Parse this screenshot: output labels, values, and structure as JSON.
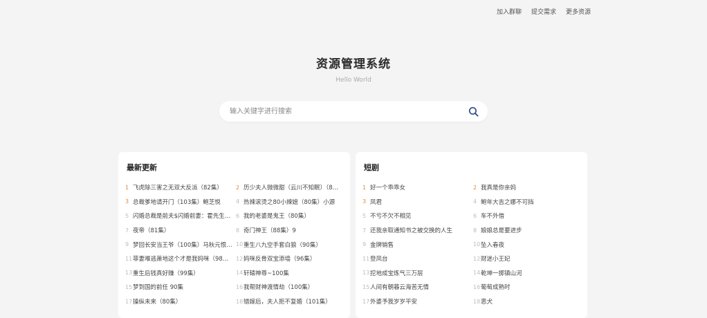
{
  "nav": [
    "加入群聊",
    "提交需求",
    "更多资源"
  ],
  "brand": {
    "title": "资源管理系统",
    "subtitle": "Hello World"
  },
  "search": {
    "placeholder": "输入关键字进行搜索",
    "value": ""
  },
  "colors": {
    "accent": "#e8842e",
    "rank_default": "#bbbbbb",
    "search_icon": "#2b4d8c"
  },
  "icons": {
    "search": "search-icon"
  },
  "sections": [
    {
      "title": "最新更新",
      "items": [
        "飞虎除三害之无双大反派（82集）",
        "历少夫人微微甜（云川不知眠）（8…",
        "总裁爹地请开门（103集）鲍芝悦",
        "热辣滚烫之80小辣媳（80集）小源",
        "闪婚总裁是前夫$闪婚前妻：霍先生…",
        "我的老婆是鬼王（80集）",
        "夜帝（81集）",
        "奇门神王（88集）9",
        "梦回长安当王爷（100集）马秋元恨…",
        "重生八九空手套白狼（90集）",
        "菲妻难逃萧地这个才是我妈咪（98…",
        "妈咪反骨双宝添墙（96集）",
        "重生后钱真好赚（99集）",
        "轩辕神尊~100集",
        "梦到国的前任 90集",
        "我帮财神渡情劫（100集）",
        "操纵未来（80集）",
        "错嫁后，夫人拒不复婚（101集）"
      ]
    },
    {
      "title": "短剧",
      "items": [
        "好一个乖乖女",
        "我真是你亲妈",
        "凤君",
        "鲍年大吉之娜不可挡",
        "不亏不欠不相见",
        "车不外借",
        "还我亲取通知书之被交换的人生",
        "娘娘总是要进步",
        "金牌销售",
        "坠入春夜",
        "登凤台",
        "财迷小王妃",
        "挖地成宝炼气三万层",
        "乾坤一掷镇山河",
        "人间有朝暮云海苦无情",
        "葡萄成熟时",
        "外婆予我岁岁平安",
        "恶犬"
      ]
    }
  ]
}
